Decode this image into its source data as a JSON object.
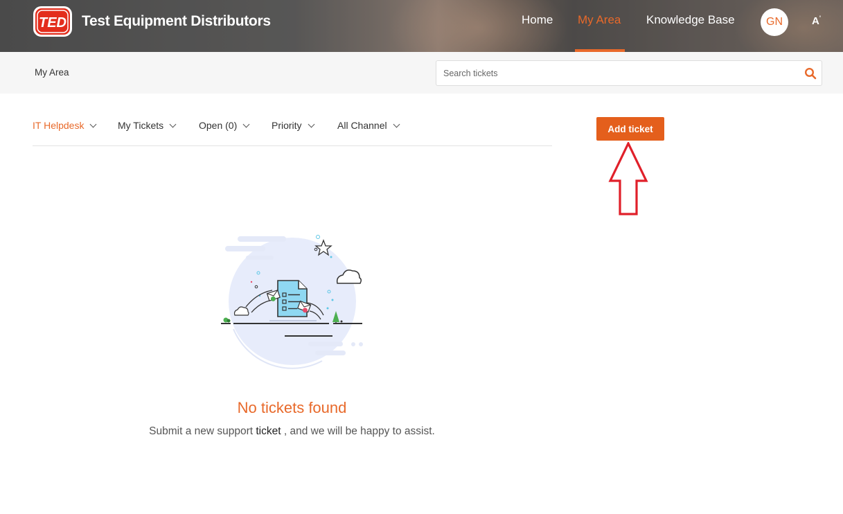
{
  "header": {
    "brand_logo_text": "TED",
    "brand_name": "Test Equipment Distributors",
    "nav": {
      "home": "Home",
      "my_area": "My Area",
      "knowledge_base": "Knowledge Base"
    },
    "active_nav": "My Area",
    "avatar_initials": "GN",
    "accessibility_label": "A",
    "accent_color": "#e8692a"
  },
  "subbar": {
    "breadcrumb": "My Area",
    "search": {
      "placeholder": "Search tickets",
      "value": ""
    }
  },
  "filters": {
    "department": "IT Helpdesk",
    "view": "My Tickets",
    "status": "Open (0)",
    "priority": "Priority",
    "channel": "All Channel"
  },
  "actions": {
    "add_ticket": "Add ticket",
    "button_color": "#e45f1c"
  },
  "annotation": {
    "type": "red-outline-arrow-up",
    "color": "#e0202a"
  },
  "empty_state": {
    "title": "No tickets found",
    "message_prefix": "Submit a new support ",
    "message_link": "ticket",
    "message_suffix": " , and we will be happy to assist."
  }
}
